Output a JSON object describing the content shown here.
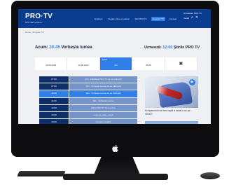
{
  "header": {
    "logo": "PRO·TV",
    "logo_sub": "ONLINE RADIO",
    "nav": [
      {
        "label": "Emisiuni"
      },
      {
        "label": "Seriale, filme si vedete"
      },
      {
        "label": "Știri PRO TV"
      },
      {
        "label": "Program TV",
        "active": true
      },
      {
        "label": "Contact"
      }
    ],
    "right_line1": "Urmărește PRO TV",
    "right_line2": "Caută"
  },
  "breadcrumb": "Home › Program TV",
  "now": {
    "label": "Acum:",
    "time": "10:45",
    "title": "Vorbește lumea"
  },
  "next": {
    "label": "Urmează:",
    "time": "12:00",
    "title": "Știrile PRO TV"
  },
  "days": [
    {
      "name": "",
      "date": "23.05.2023",
      "active": false
    },
    {
      "name": "",
      "date": "24.05.2023",
      "active": false
    },
    {
      "name": "Astăzi",
      "date": "Azi",
      "active": true
    },
    {
      "name": "",
      "date": "26.05",
      "active": false
    },
    {
      "name": "",
      "date": "",
      "active": false,
      "calendar": true
    }
  ],
  "schedule": [
    {
      "time": "07:00",
      "title": "Știri - Mădălina PRO TV ce se întâmplă",
      "active": false
    },
    {
      "time": "07:00",
      "title": "Știri - Vorbește Lumea ce se întâmplă",
      "active": false
    },
    {
      "time": "10:45",
      "title": "Știri - Vorbește Lumea ce se întâmplă",
      "active": true
    },
    {
      "time": "11:00",
      "title": "Știri - Vorbește Lumea",
      "active": false
    },
    {
      "time": "12:00",
      "title": "Știrile PRO TV de la prânz",
      "active": false
    },
    {
      "time": "13:00",
      "title": "Lecții de viață - serial",
      "active": false
    },
    {
      "time": "14:00",
      "title": "Ce spun românii",
      "active": false
    },
    {
      "time": "15:00",
      "title": "Știri - Mădălina PRO TV ce se întâmplă",
      "active": false
    },
    {
      "time": "16:00",
      "title": "Vorbește lumea",
      "active": false
    },
    {
      "time": "17:00",
      "title": "Știrile PRO TV",
      "active": false
    },
    {
      "time": "19:00",
      "title": "Știrile PRO TV",
      "active": false
    }
  ],
  "right_caption": "Echipamentul de test rapid a intrat în uz pe ... VIDEO",
  "icons": {
    "play": "play-icon",
    "apple": "apple-logo",
    "calendar": "calendar-icon"
  }
}
